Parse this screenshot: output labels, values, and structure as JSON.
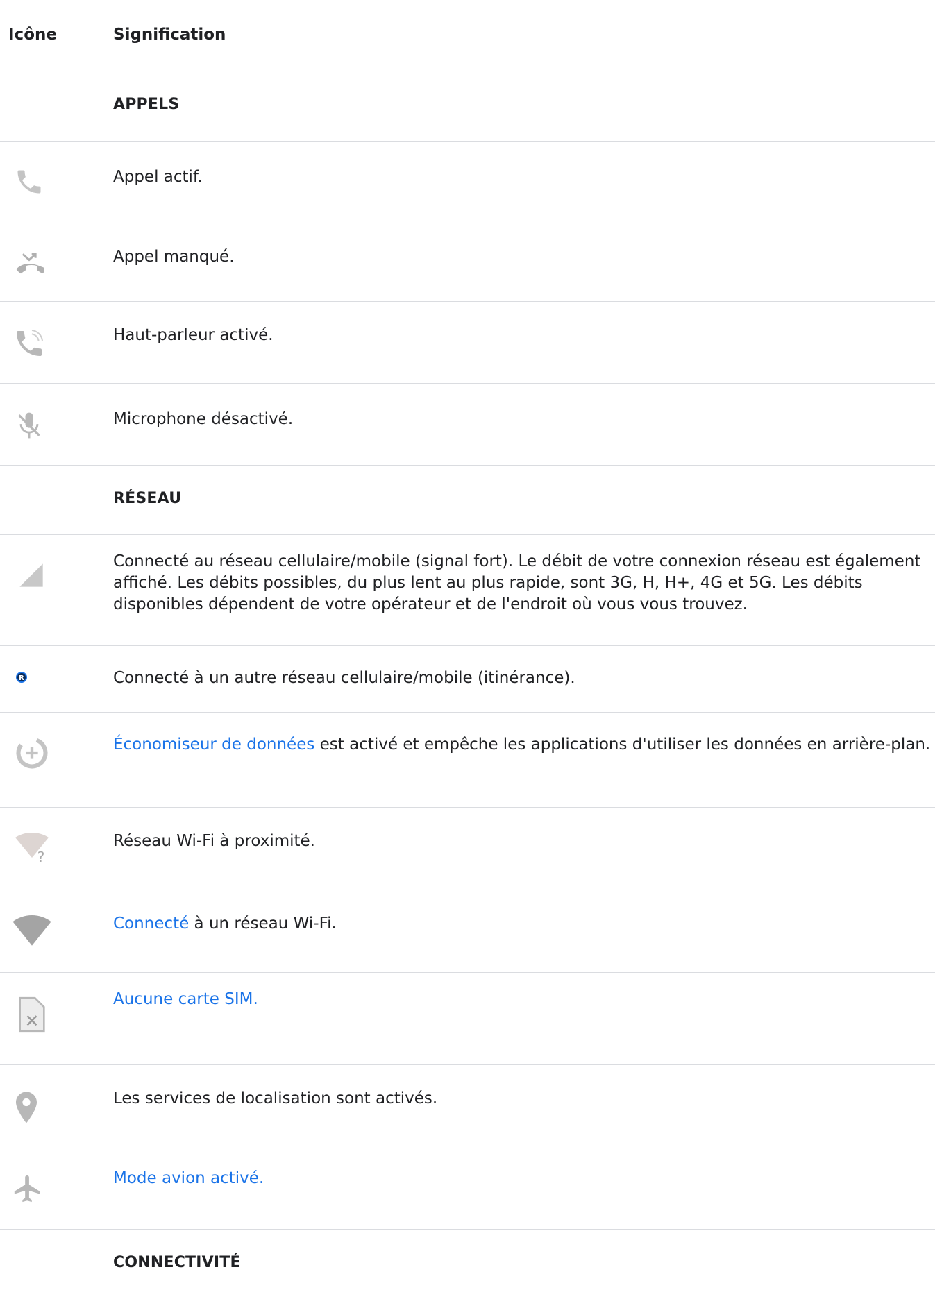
{
  "header": {
    "col_icon": "Icône",
    "col_meaning": "Signification"
  },
  "sections": {
    "calls": "APPELS",
    "network": "RÉSEAU",
    "connectivity": "CONNECTIVITÉ"
  },
  "rows": {
    "active_call": "Appel actif.",
    "missed_call": "Appel manqué.",
    "speaker_on": "Haut-parleur activé.",
    "mic_off": "Microphone désactivé.",
    "cellular_strong": "Connecté au réseau cellulaire/mobile (signal fort). Le débit de votre connexion réseau est également affiché. Les débits possibles, du plus lent au plus rapide, sont 3G, H, H+, 4G et 5G. Les débits disponibles dépendent de votre opérateur et de l'endroit où vous vous trouvez.",
    "roaming": "Connecté à un autre réseau cellulaire/mobile (itinérance).",
    "data_saver_link": "Économiseur de données",
    "data_saver_rest": " est activé et empêche les applications d'utiliser les données en arrière-plan.",
    "wifi_nearby": "Réseau Wi-Fi à proximité.",
    "wifi_connected_link": "Connecté",
    "wifi_connected_rest": " à un réseau Wi-Fi.",
    "no_sim_link": "Aucune carte SIM.",
    "location_on": "Les services de localisation sont activés.",
    "airplane_link": "Mode avion activé."
  },
  "icons": {
    "active_call": "phone-icon",
    "missed_call": "missed-call-icon",
    "speaker_on": "speakerphone-icon",
    "mic_off": "mic-off-icon",
    "cellular_strong": "cellular-signal-icon",
    "roaming": "roaming-icon",
    "roaming_glyph": "R",
    "data_saver": "data-saver-icon",
    "wifi_nearby": "wifi-question-icon",
    "wifi_nearby_glyph": "?",
    "wifi_connected": "wifi-icon",
    "no_sim": "no-sim-icon",
    "location": "location-pin-icon",
    "airplane": "airplane-icon"
  },
  "colors": {
    "icon_gray": "#a6a6a6",
    "link_blue": "#1a73e8",
    "roaming_blue": "#1a73e8",
    "divider": "#dadce0"
  }
}
